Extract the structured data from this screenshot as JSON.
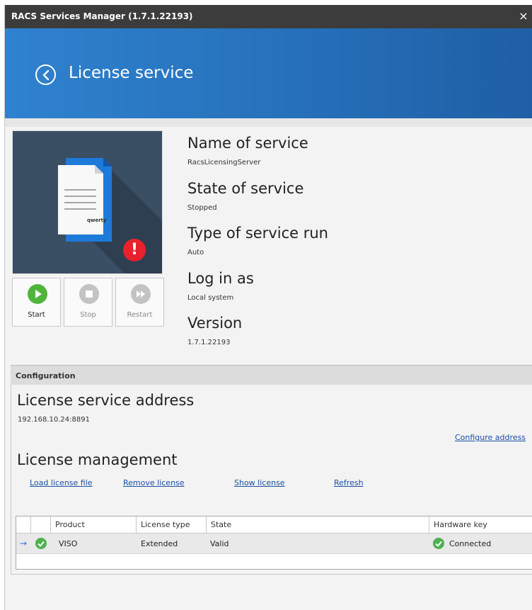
{
  "window": {
    "title": "RACS Services Manager (1.7.1.22193)",
    "close_glyph": "×"
  },
  "header": {
    "title": "License service",
    "back_icon": "chevron-left-circle-icon",
    "accent": "#2f82cf"
  },
  "tile": {
    "document_text": "qwerty",
    "alert_glyph": "!",
    "alert_color": "#e8212c"
  },
  "controls": {
    "start_label": "Start",
    "stop_label": "Stop",
    "restart_label": "Restart",
    "start_color": "#4fb53a",
    "disabled_color": "#c3c3c3"
  },
  "properties": [
    {
      "title": "Name of service",
      "value": "RacsLicensingServer"
    },
    {
      "title": "State of service",
      "value": "Stopped"
    },
    {
      "title": "Type of service run",
      "value": "Auto"
    },
    {
      "title": "Log in as",
      "value": "Local system"
    },
    {
      "title": "Version",
      "value": "1.7.1.22193"
    }
  ],
  "configuration": {
    "section_label": "Configuration",
    "address_title": "License service address",
    "address_value": "192.168.10.24:8891",
    "configure_link": "Configure address",
    "management_title": "License management",
    "actions": {
      "load": "Load license file",
      "remove": "Remove license",
      "show": "Show license",
      "refresh": "Refresh"
    }
  },
  "grid": {
    "columns": [
      "Product",
      "License type",
      "State",
      "Hardware key"
    ],
    "rows": [
      {
        "indicator": "→",
        "product": "VISO",
        "license_type": "Extended",
        "state": "Valid",
        "hardware_key": "Connected"
      }
    ]
  }
}
